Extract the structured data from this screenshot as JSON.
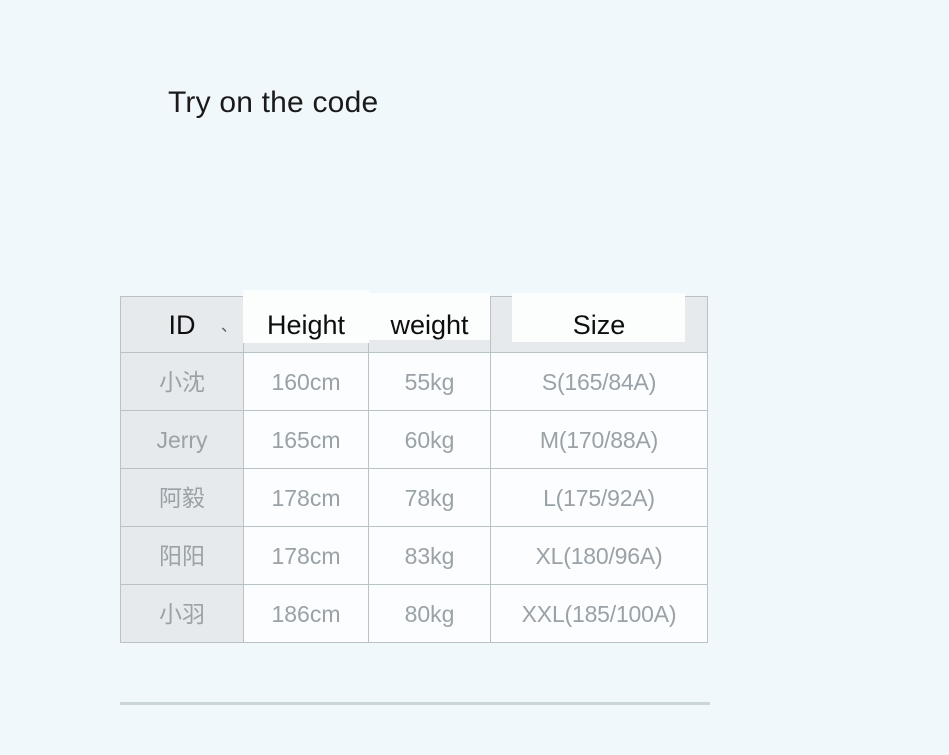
{
  "page": {
    "title": "Try on the code",
    "background_color": "#f1f8fc"
  },
  "colors": {
    "header_bg": "#e6eaec",
    "cell_bg": "#fbfdfe",
    "border": "#b9c2c6",
    "header_text": "#0e0e0e",
    "cell_text": "#9aa2a7",
    "divider": "#c9d6da"
  },
  "size_table": {
    "headers": {
      "id": "ID",
      "id_mark": "、",
      "height": "Height",
      "weight": "weight",
      "size": "Size"
    },
    "rows": [
      {
        "id": "小沈",
        "height": "160cm",
        "weight": "55kg",
        "size": "S(165/84A)"
      },
      {
        "id": "Jerry",
        "height": "165cm",
        "weight": "60kg",
        "size": "M(170/88A)"
      },
      {
        "id": "阿毅",
        "height": "178cm",
        "weight": "78kg",
        "size": "L(175/92A)"
      },
      {
        "id": "阳阳",
        "height": "178cm",
        "weight": "83kg",
        "size": "XL(180/96A)"
      },
      {
        "id": "小羽",
        "height": "186cm",
        "weight": "80kg",
        "size": "XXL(185/100A)"
      }
    ]
  }
}
